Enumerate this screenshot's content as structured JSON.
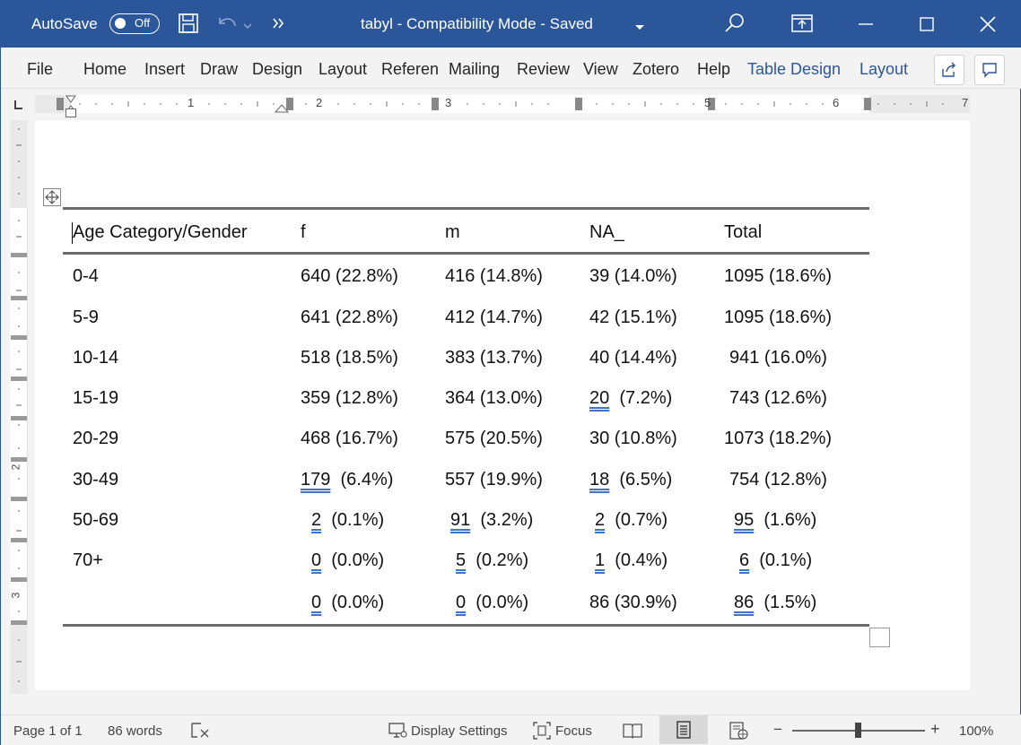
{
  "titlebar": {
    "autosave_label": "AutoSave",
    "autosave_state": "Off",
    "document_title": "tabyl  -  Compatibility Mode  -  Saved",
    "icons": [
      "save-icon",
      "undo-icon",
      "more-commands-icon",
      "search-icon",
      "ribbon-display-icon",
      "minimize-icon",
      "maximize-icon",
      "close-icon"
    ]
  },
  "ribbon": {
    "tabs": [
      "File",
      "Home",
      "Insert",
      "Draw",
      "Design",
      "Layout",
      "Referen",
      "Mailing",
      "Review",
      "View",
      "Zotero",
      "Help"
    ],
    "context_tabs": [
      "Table Design",
      "Layout"
    ],
    "accent_color": "#2b579a"
  },
  "ruler": {
    "numbers": [
      "1",
      "2",
      "3",
      "5",
      "6",
      "7"
    ]
  },
  "vruler": {
    "numbers": [
      "2",
      "3"
    ]
  },
  "table": {
    "headers": [
      "Age Category/Gender",
      "f",
      "m",
      "NA_",
      "Total"
    ],
    "rows": [
      {
        "age": "0-4",
        "f": [
          "640",
          " (22.8%)"
        ],
        "m": [
          "416",
          " (14.8%)"
        ],
        "na": [
          "39",
          " (14.0%)"
        ],
        "total": [
          "1095",
          " (18.6%)"
        ]
      },
      {
        "age": "5-9",
        "f": [
          "641",
          " (22.8%)"
        ],
        "m": [
          "412",
          " (14.7%)"
        ],
        "na": [
          "42",
          " (15.1%)"
        ],
        "total": [
          "1095",
          " (18.6%)"
        ]
      },
      {
        "age": "10-14",
        "f": [
          "518",
          " (18.5%)"
        ],
        "m": [
          "383",
          " (13.7%)"
        ],
        "na": [
          "40",
          " (14.4%)"
        ],
        "total": [
          "941",
          " (16.0%)"
        ]
      },
      {
        "age": "15-19",
        "f": [
          "359",
          " (12.8%)"
        ],
        "m": [
          "364",
          " (13.0%)"
        ],
        "na": [
          "20",
          "  (7.2%)"
        ],
        "total": [
          "743",
          " (12.6%)"
        ]
      },
      {
        "age": "20-29",
        "f": [
          "468",
          " (16.7%)"
        ],
        "m": [
          "575",
          " (20.5%)"
        ],
        "na": [
          "30",
          " (10.8%)"
        ],
        "total": [
          "1073",
          " (18.2%)"
        ]
      },
      {
        "age": "30-49",
        "f": [
          "179",
          "  (6.4%)"
        ],
        "m": [
          "557",
          " (19.9%)"
        ],
        "na": [
          "18",
          "  (6.5%)"
        ],
        "total": [
          "754",
          " (12.8%)"
        ]
      },
      {
        "age": "50-69",
        "f": [
          "2",
          "  (0.1%)"
        ],
        "m": [
          "91",
          "  (3.2%)"
        ],
        "na": [
          "2",
          "  (0.7%)"
        ],
        "total": [
          "95",
          "  (1.6%)"
        ]
      },
      {
        "age": "70+",
        "f": [
          "0",
          "  (0.0%)"
        ],
        "m": [
          "5",
          "  (0.2%)"
        ],
        "na": [
          "1",
          "  (0.4%)"
        ],
        "total": [
          "6",
          "  (0.1%)"
        ]
      },
      {
        "age": "",
        "f": [
          "0",
          "  (0.0%)"
        ],
        "m": [
          "0",
          "  (0.0%)"
        ],
        "na": [
          "86",
          " (30.9%)"
        ],
        "total": [
          "86",
          "  (1.5%)"
        ]
      }
    ]
  },
  "statusbar": {
    "page": "Page 1 of 1",
    "words": "86 words",
    "display_settings": "Display Settings",
    "focus": "Focus",
    "zoom_minus": "−",
    "zoom_plus": "+",
    "zoom": "100%",
    "zoom_level": 1.0
  }
}
